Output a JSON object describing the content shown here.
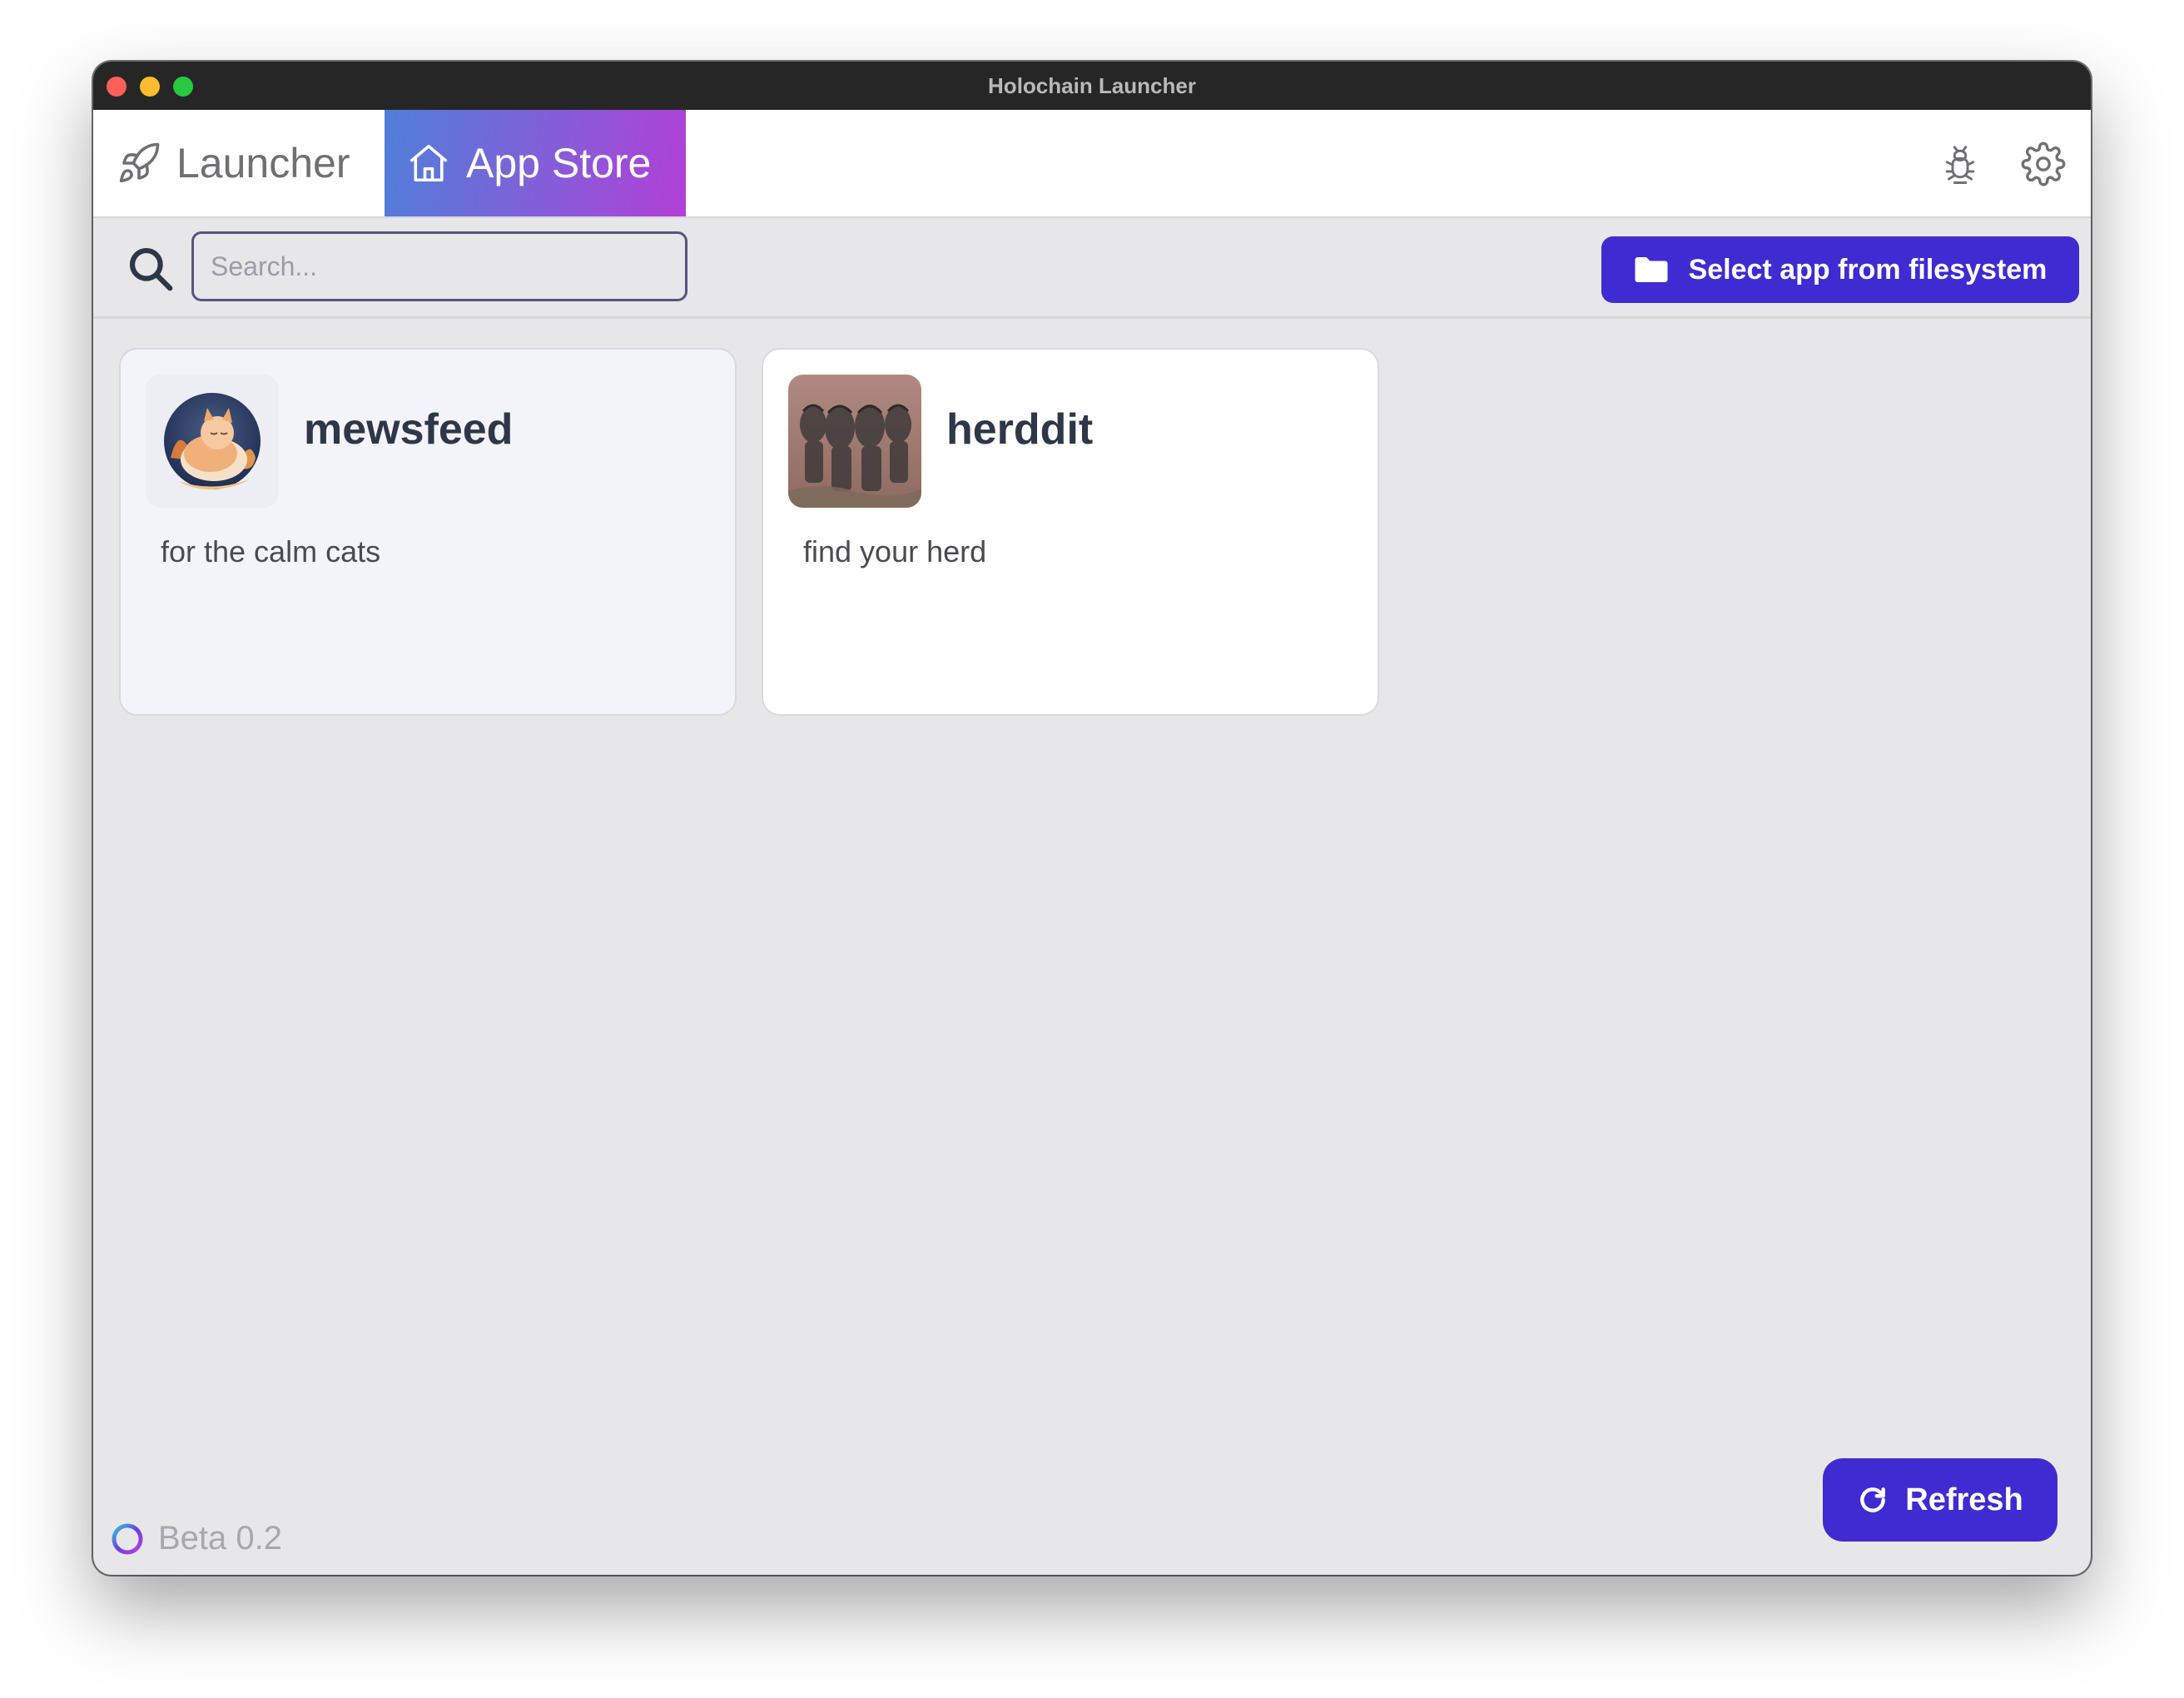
{
  "window": {
    "title": "Holochain Launcher"
  },
  "header": {
    "tabs": [
      {
        "label": "Launcher",
        "icon": "rocket-icon",
        "active": false
      },
      {
        "label": "App Store",
        "icon": "home-icon",
        "active": true
      }
    ],
    "right_icons": [
      "debug-icon",
      "gear-icon"
    ]
  },
  "toolbar": {
    "search_placeholder": "Search...",
    "search_value": "",
    "select_button_label": "Select app from filesystem"
  },
  "apps": [
    {
      "name": "mewsfeed",
      "description": "for the calm cats"
    },
    {
      "name": "herddit",
      "description": "find your herd"
    }
  ],
  "footer": {
    "version_label": "Beta 0.2",
    "refresh_label": "Refresh"
  },
  "colors": {
    "accent": "#3f2bd1",
    "tab_gradient_start": "#4f7fd9",
    "tab_gradient_end": "#b23fd6",
    "background": "#e7e7ea"
  }
}
